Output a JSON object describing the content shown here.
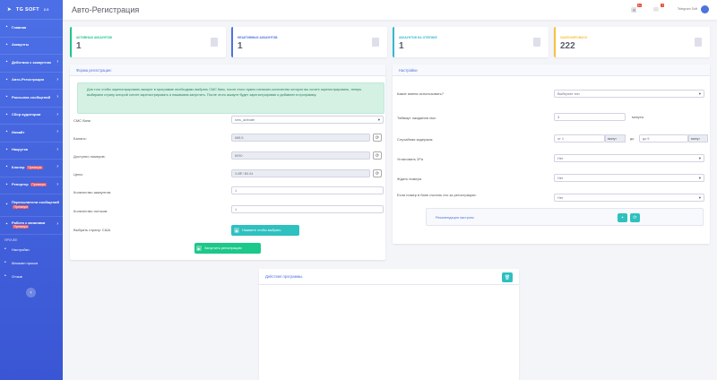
{
  "app": {
    "brand": "TG SOFT",
    "version": "2.0"
  },
  "sidebar": {
    "items": [
      {
        "label": "Главная",
        "icon": "home-icon",
        "chevron": false,
        "badge": ""
      },
      {
        "label": "Аккаунты",
        "icon": "users-icon",
        "chevron": false,
        "badge": ""
      },
      {
        "label": "Действия с аккаунтом",
        "icon": "gear-icon",
        "chevron": true,
        "badge": ""
      },
      {
        "label": "Авто-Регистрация",
        "icon": "plane-icon",
        "chevron": true,
        "badge": ""
      },
      {
        "label": "Рассылка сообщений",
        "icon": "envelope-icon",
        "chevron": true,
        "badge": ""
      },
      {
        "label": "Сбор аудитории",
        "icon": "chart-icon",
        "chevron": true,
        "badge": ""
      },
      {
        "label": "Инвайт",
        "icon": "invite-icon",
        "chevron": true,
        "badge": ""
      },
      {
        "label": "Накрутка",
        "icon": "boost-icon",
        "chevron": true,
        "badge": ""
      },
      {
        "label": "Клонер",
        "icon": "clone-icon",
        "chevron": true,
        "badge": "Премиум"
      },
      {
        "label": "Репортер",
        "icon": "report-icon",
        "chevron": true,
        "badge": "Премиум"
      },
      {
        "label": "Пересылатели сообщений",
        "icon": "forward-icon",
        "chevron": false,
        "badge": "Премиум"
      },
      {
        "label": "Работа с каналами",
        "icon": "channel-icon",
        "chevron": true,
        "badge": "Премиум"
      }
    ],
    "section_label": "ПРОЧЕЕ",
    "extra": [
      {
        "label": "Настройки",
        "icon": "settings-icon"
      },
      {
        "label": "Магазин прокси",
        "icon": "shop-icon"
      },
      {
        "label": "Отзыв",
        "icon": "feedback-icon"
      }
    ]
  },
  "header": {
    "title": "Авто-Регистрация",
    "user": "Telegram Soft",
    "bell_badge": "3+",
    "mail_badge": "7"
  },
  "stats": [
    {
      "label": "Активных аккаунтов",
      "value": "1",
      "color": "#1cc88a"
    },
    {
      "label": "Неактивных аккаунтов",
      "value": "1",
      "color": "#4e73df"
    },
    {
      "label": "Аккаунтов на отлежке",
      "value": "1",
      "color": "#36b9cc"
    },
    {
      "label": "Заблокировано",
      "value": "222",
      "color": "#f6c23e"
    }
  ],
  "form": {
    "title": "Форма регистрации:",
    "alert": "Для того чтобы зарегистрировать аккаунт в программе необходимо выбрать СМС банк, после этого нужно написать количество которое вы хотите зарегистрировать, теперь выбираем страну которой хотите зарегистрировать и нажимаем запустить. После этого аккаунт будет зарегистрирован и добавлен в программу.",
    "sms_label": "СМС банк:",
    "sms_value": "sms_activate",
    "balance_label": "Баланс:",
    "balance_value": "688.5",
    "available_label": "Доступно номеров:",
    "available_value": "8930",
    "price_label": "Цена:",
    "price_value": "3.0₽ / $0.04",
    "accounts_label": "Количество аккаунтов:",
    "accounts_value": "1",
    "threads_label": "Количество потоков:",
    "threads_value": "1",
    "country_label": "Выбрать страну: США",
    "country_button": "Нажмите чтобы выбрать",
    "start_button": "Запустить регистрацию"
  },
  "settings": {
    "title": "Настройки",
    "names_label": "Какие имена использовать?",
    "names_value": "Выберите тип",
    "timeout_label": "Таймаут ожидания смс:",
    "timeout_value": "3",
    "timeout_unit": "минуты",
    "delay_label": "Случайная задержка:",
    "delay_from": "от 1",
    "delay_unit1": "минут",
    "delay_mid": "до",
    "delay_to": "до 5",
    "delay_unit2": "минут",
    "twofa_label": "Установить 2Fa",
    "twofa_value": "Нет",
    "wait_label": "Ждать номера",
    "wait_value": "Нет",
    "ban_label": "Если номер в бане считать его за регистрацию:",
    "ban_value": "Нет",
    "recommend_label": "Рекомендация настроек"
  },
  "log": {
    "title": "Действия программы"
  }
}
